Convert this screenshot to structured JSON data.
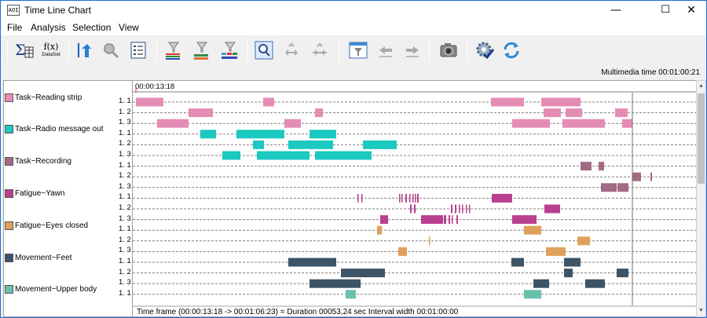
{
  "window": {
    "title": "Time Line Chart",
    "app_icon_text": "AOI"
  },
  "controls": {
    "minimize": "—",
    "maximize": "☐",
    "close": "✕"
  },
  "menu": [
    "File",
    "Analysis",
    "Selection",
    "View"
  ],
  "toolbar": {
    "buttons": [
      "sum-icon",
      "fx-dataset-icon",
      "go-start-icon",
      "zoom-gray-icon",
      "list-icon",
      "filter-a-icon",
      "filter-b-icon",
      "filter-c-icon",
      "zoom-window-icon",
      "expand-gray-icon",
      "collapse-gray-icon",
      "filter-window-icon",
      "arrow-left-gray-icon",
      "arrow-right-gray-icon",
      "camera-icon",
      "settings-check-icon",
      "refresh-icon"
    ],
    "fx_label": "f(x)",
    "dataset_label": "DataSet"
  },
  "multimedia_time": "Multimedia time 00:01:00:21",
  "timeline": {
    "start_label": "00:00:13:18",
    "status": "Time frame  (00:00:13:18 -> 00:01:06:23) = Duration 00053,24 sec    Interval width 00:01:00:00"
  },
  "categories": [
    {
      "label": "Task~Reading strip",
      "color": "#e58cb5",
      "rows": [
        {
          "label": "1. 1",
          "bars": [
            [
              0,
              35
            ],
            [
              162,
              176
            ],
            [
              452,
              494
            ],
            [
              516,
              566
            ]
          ]
        },
        {
          "label": "1. 2",
          "bars": [
            [
              67,
              98
            ],
            [
              228,
              238
            ],
            [
              519,
              541
            ],
            [
              547,
              568
            ],
            [
              610,
              626
            ]
          ]
        },
        {
          "label": "1. 3",
          "bars": [
            [
              27,
              67
            ],
            [
              189,
              210
            ],
            [
              479,
              527
            ],
            [
              543,
              597
            ],
            [
              619,
              632
            ]
          ]
        }
      ]
    },
    {
      "label": "Task~Radio message out",
      "color": "#1bc9c0",
      "rows": [
        {
          "label": "1. 1",
          "bars": [
            [
              82,
              102
            ],
            [
              128,
              189
            ],
            [
              221,
              255
            ]
          ]
        },
        {
          "label": "1. 2",
          "bars": [
            [
              149,
              163
            ],
            [
              194,
              251
            ],
            [
              289,
              332
            ]
          ]
        },
        {
          "label": "1. 3",
          "bars": [
            [
              110,
              133
            ],
            [
              154,
              221
            ],
            [
              228,
              300
            ]
          ]
        }
      ]
    },
    {
      "label": "Task~Recording",
      "color": "#a36a86",
      "rows": [
        {
          "label": "1. 1",
          "bars": [
            [
              566,
              580
            ],
            [
              589,
              596
            ]
          ]
        },
        {
          "label": "1. 2",
          "bars": [
            [
              632,
              643
            ],
            [
              655,
              657
            ]
          ]
        },
        {
          "label": "1. 3",
          "bars": [
            [
              592,
              612
            ],
            [
              613,
              627
            ]
          ]
        }
      ]
    },
    {
      "label": "Fatigue~Yawn",
      "color": "#b8408f",
      "rows": [
        {
          "label": "1. 1",
          "bars": [
            [
              282,
              283
            ],
            [
              287,
              288
            ],
            [
              335,
              336
            ],
            [
              338,
              339
            ],
            [
              343,
              345
            ],
            [
              348,
              349
            ],
            [
              352,
              353
            ],
            [
              355,
              356
            ],
            [
              358,
              360
            ],
            [
              453,
              479
            ]
          ]
        },
        {
          "label": "1. 2",
          "bars": [
            [
              349,
              351
            ],
            [
              354,
              356
            ],
            [
              401,
              403
            ],
            [
              406,
              408
            ],
            [
              411,
              412
            ],
            [
              415,
              416
            ],
            [
              420,
              421
            ],
            [
              424,
              425
            ],
            [
              520,
              540
            ]
          ]
        },
        {
          "label": "1. 3",
          "bars": [
            [
              311,
              321
            ],
            [
              363,
              391
            ],
            [
              392,
              395
            ],
            [
              398,
              400
            ],
            [
              402,
              403
            ],
            [
              408,
              410
            ],
            [
              479,
              510
            ]
          ]
        }
      ]
    },
    {
      "label": "Fatigue~Eyes closed",
      "color": "#e0a05d",
      "rows": [
        {
          "label": "1. 1",
          "bars": [
            [
              307,
              313
            ],
            [
              494,
              516
            ]
          ]
        },
        {
          "label": "1. 2",
          "bars": [
            [
              373,
              374
            ],
            [
              562,
              578
            ]
          ]
        },
        {
          "label": "1. 3",
          "bars": [
            [
              334,
              345
            ],
            [
              522,
              547
            ]
          ]
        }
      ]
    },
    {
      "label": "Movement~Feet",
      "color": "#3d5466",
      "rows": [
        {
          "label": "1. 1",
          "bars": [
            [
              194,
              255
            ],
            [
              478,
              494
            ],
            [
              545,
              566
            ]
          ]
        },
        {
          "label": "1. 2",
          "bars": [
            [
              261,
              317
            ],
            [
              545,
              556
            ],
            [
              612,
              627
            ]
          ]
        },
        {
          "label": "1. 3",
          "bars": [
            [
              221,
              286
            ],
            [
              506,
              526
            ],
            [
              572,
              597
            ]
          ]
        }
      ]
    },
    {
      "label": "Movement~Upper body",
      "color": "#6bbfad",
      "rows": [
        {
          "label": "1. 1",
          "bars": [
            [
              267,
              280
            ],
            [
              494,
              516
            ]
          ]
        }
      ]
    }
  ]
}
